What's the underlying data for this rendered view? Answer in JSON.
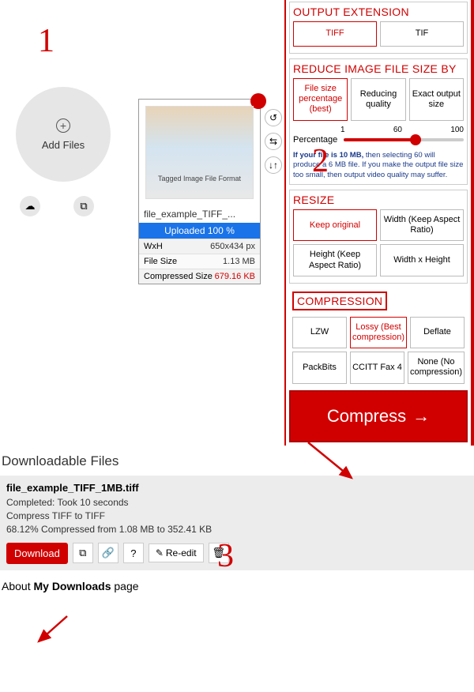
{
  "steps": {
    "one": "1",
    "two": "2",
    "three": "3"
  },
  "addFiles": {
    "label": "Add Files",
    "cloudIcon": "cloud",
    "dropboxIcon": "dropbox"
  },
  "fileCard": {
    "thumbLabel": "Tagged Image File Format",
    "fileName": "file_example_TIFF_...",
    "progress": "Uploaded 100 %",
    "rows": [
      {
        "label": "WxH",
        "value": "650x434 px"
      },
      {
        "label": "File Size",
        "value": "1.13 MB"
      },
      {
        "label": "Compressed Size",
        "value": "679.16 KB",
        "red": true
      }
    ]
  },
  "panels": {
    "outputExt": {
      "title": "OUTPUT EXTENSION",
      "options": [
        {
          "label": "TIFF",
          "selected": true
        },
        {
          "label": "TIF",
          "selected": false
        }
      ]
    },
    "reduce": {
      "title": "REDUCE IMAGE FILE SIZE BY",
      "options": [
        {
          "label": "File size percentage (best)",
          "selected": true
        },
        {
          "label": "Reducing quality",
          "selected": false
        },
        {
          "label": "Exact output size",
          "selected": false
        }
      ],
      "sliderLabel": "Percentage",
      "ticks": [
        "1",
        "60",
        "100"
      ],
      "hintPrefix": "If your file is 10 MB,",
      "hintRest": " then selecting 60 will produce a 6 MB file. If you make the output file size too small, then output video quality may suffer."
    },
    "resize": {
      "title": "RESIZE",
      "row1": [
        {
          "label": "Keep original",
          "selected": true
        },
        {
          "label": "Width (Keep Aspect Ratio)",
          "selected": false
        }
      ],
      "row2": [
        {
          "label": "Height (Keep Aspect Ratio)",
          "selected": false
        },
        {
          "label": "Width x Height",
          "selected": false
        }
      ]
    },
    "compression": {
      "title": "COMPRESSION",
      "row1": [
        {
          "label": "LZW",
          "selected": false
        },
        {
          "label": "Lossy (Best compression)",
          "selected": true
        },
        {
          "label": "Deflate",
          "selected": false
        }
      ],
      "row2": [
        {
          "label": "PackBits",
          "selected": false
        },
        {
          "label": "CCITT Fax 4",
          "selected": false
        },
        {
          "label": "None (No compression)",
          "selected": false
        }
      ]
    },
    "compressBtn": "Compress"
  },
  "downloadable": {
    "title": "Downloadable Files",
    "fileName": "file_example_TIFF_1MB.tiff",
    "lines": [
      "Completed: Took 10 seconds",
      "Compress TIFF to TIFF",
      "68.12% Compressed from 1.08 MB to 352.41 KB"
    ],
    "downloadBtn": "Download",
    "reeditBtn": "Re-edit"
  },
  "about": {
    "prefix": "About ",
    "bold": "My Downloads",
    "suffix": " page"
  }
}
